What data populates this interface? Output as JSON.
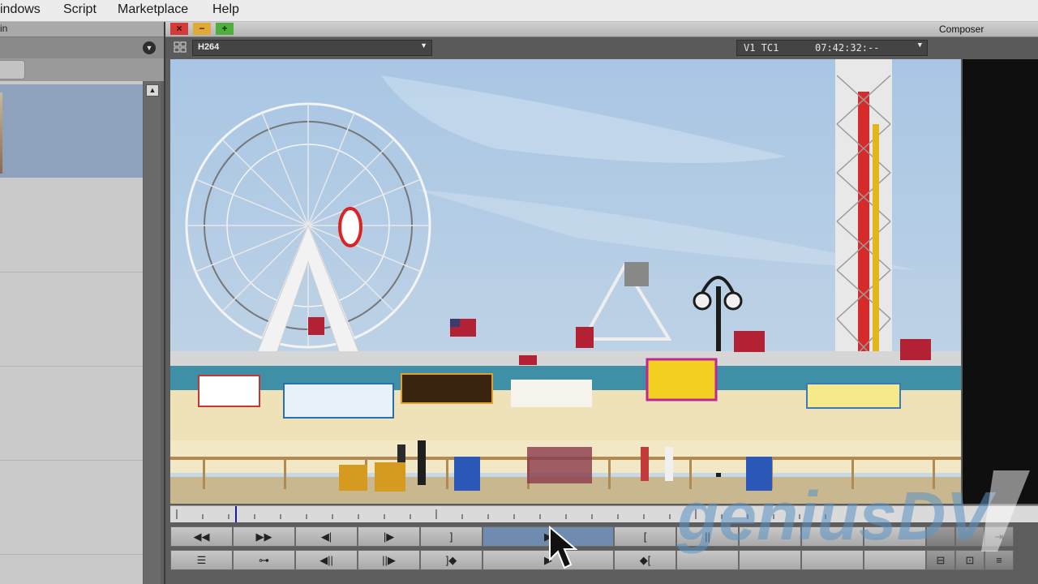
{
  "menubar": {
    "items": [
      "indows",
      "Script",
      "Marketplace",
      "Help"
    ]
  },
  "bin": {
    "title": "Bin",
    "menu_icon": "chevron-down-icon",
    "scroll_up_icon": "up-arrow-icon"
  },
  "composer": {
    "title": "Composer",
    "window_buttons": [
      "×",
      "−",
      "+"
    ],
    "clip_name": "H264",
    "track": "V1  TC1",
    "timecode": "07:42:32:--",
    "position_indicator_fraction": 0.075
  },
  "controls": {
    "row1": [
      {
        "name": "rewind-button",
        "glyph": "◀◀"
      },
      {
        "name": "fast-forward-button",
        "glyph": "▶▶"
      },
      {
        "name": "step-back-button",
        "glyph": "◀|"
      },
      {
        "name": "step-forward-button",
        "glyph": "|▶"
      },
      {
        "name": "mark-out-button",
        "glyph": "]"
      },
      {
        "name": "play-button",
        "glyph": "▶"
      },
      {
        "name": "mark-in-button",
        "glyph": "["
      },
      {
        "name": "pause-button",
        "glyph": "||"
      },
      {
        "name": "blank-button",
        "glyph": ""
      },
      {
        "name": "blank-button",
        "glyph": ""
      },
      {
        "name": "blank-button",
        "glyph": ""
      },
      {
        "name": "blank-button",
        "glyph": ""
      },
      {
        "name": "blank-button",
        "glyph": ""
      },
      {
        "name": "export-button",
        "glyph": "⇥"
      }
    ],
    "row2": [
      {
        "name": "list-button",
        "glyph": "☰"
      },
      {
        "name": "link-button",
        "glyph": "⊶"
      },
      {
        "name": "step-back-frame-button",
        "glyph": "◀||"
      },
      {
        "name": "step-forward-frame-button",
        "glyph": "||▶"
      },
      {
        "name": "go-to-out-button",
        "glyph": "]◆"
      },
      {
        "name": "play-loop-button",
        "glyph": "▶"
      },
      {
        "name": "go-to-in-button",
        "glyph": "◆["
      },
      {
        "name": "blank-button",
        "glyph": ""
      },
      {
        "name": "blank-button",
        "glyph": ""
      },
      {
        "name": "blank-button",
        "glyph": ""
      },
      {
        "name": "blank-button",
        "glyph": ""
      },
      {
        "name": "single-view-button",
        "glyph": "⊟"
      },
      {
        "name": "split-view-button",
        "glyph": "⊡"
      },
      {
        "name": "settings-button",
        "glyph": "≡"
      }
    ]
  },
  "watermark": {
    "text": "geniusDV"
  },
  "colors": {
    "accent_blue": "#6f8bb0",
    "sky": "#9fbfde",
    "ride_red": "#d62b2b"
  }
}
